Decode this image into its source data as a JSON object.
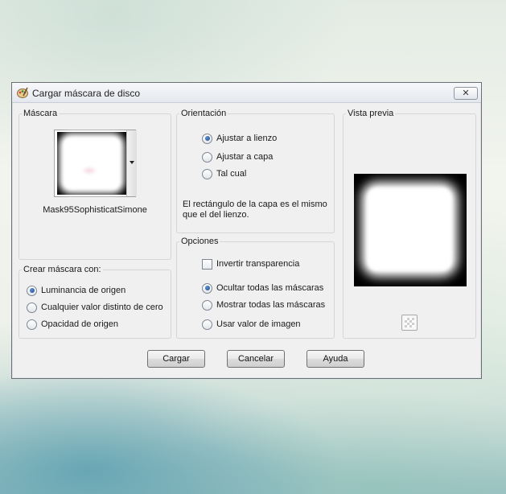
{
  "dialog": {
    "title": "Cargar máscara de disco",
    "close_symbol": "✕",
    "app_icon": "paint-palette-icon"
  },
  "mask_group": {
    "legend": "Máscara",
    "file_name": "Mask95SophisticatSimone"
  },
  "orientation_group": {
    "legend": "Orientación",
    "options": [
      {
        "label": "Ajustar a lienzo",
        "selected": true
      },
      {
        "label": "Ajustar a capa",
        "selected": false
      },
      {
        "label": "Tal cual",
        "selected": false
      }
    ],
    "description": "El rectángulo de la capa es el mismo que el del lienzo."
  },
  "create_group": {
    "legend": "Crear máscara con:",
    "options": [
      {
        "label": "Luminancia de origen",
        "selected": true
      },
      {
        "label": "Cualquier valor distinto de cero",
        "selected": false
      },
      {
        "label": "Opacidad de origen",
        "selected": false
      }
    ]
  },
  "options_group": {
    "legend": "Opciones",
    "invert_label": "Invertir transparencia",
    "invert_checked": false,
    "options": [
      {
        "label": "Ocultar todas las máscaras",
        "selected": true
      },
      {
        "label": "Mostrar todas las máscaras",
        "selected": false
      },
      {
        "label": "Usar valor de imagen",
        "selected": false
      }
    ]
  },
  "preview_group": {
    "legend": "Vista previa"
  },
  "buttons": {
    "load": "Cargar",
    "cancel": "Cancelar",
    "help": "Ayuda"
  }
}
